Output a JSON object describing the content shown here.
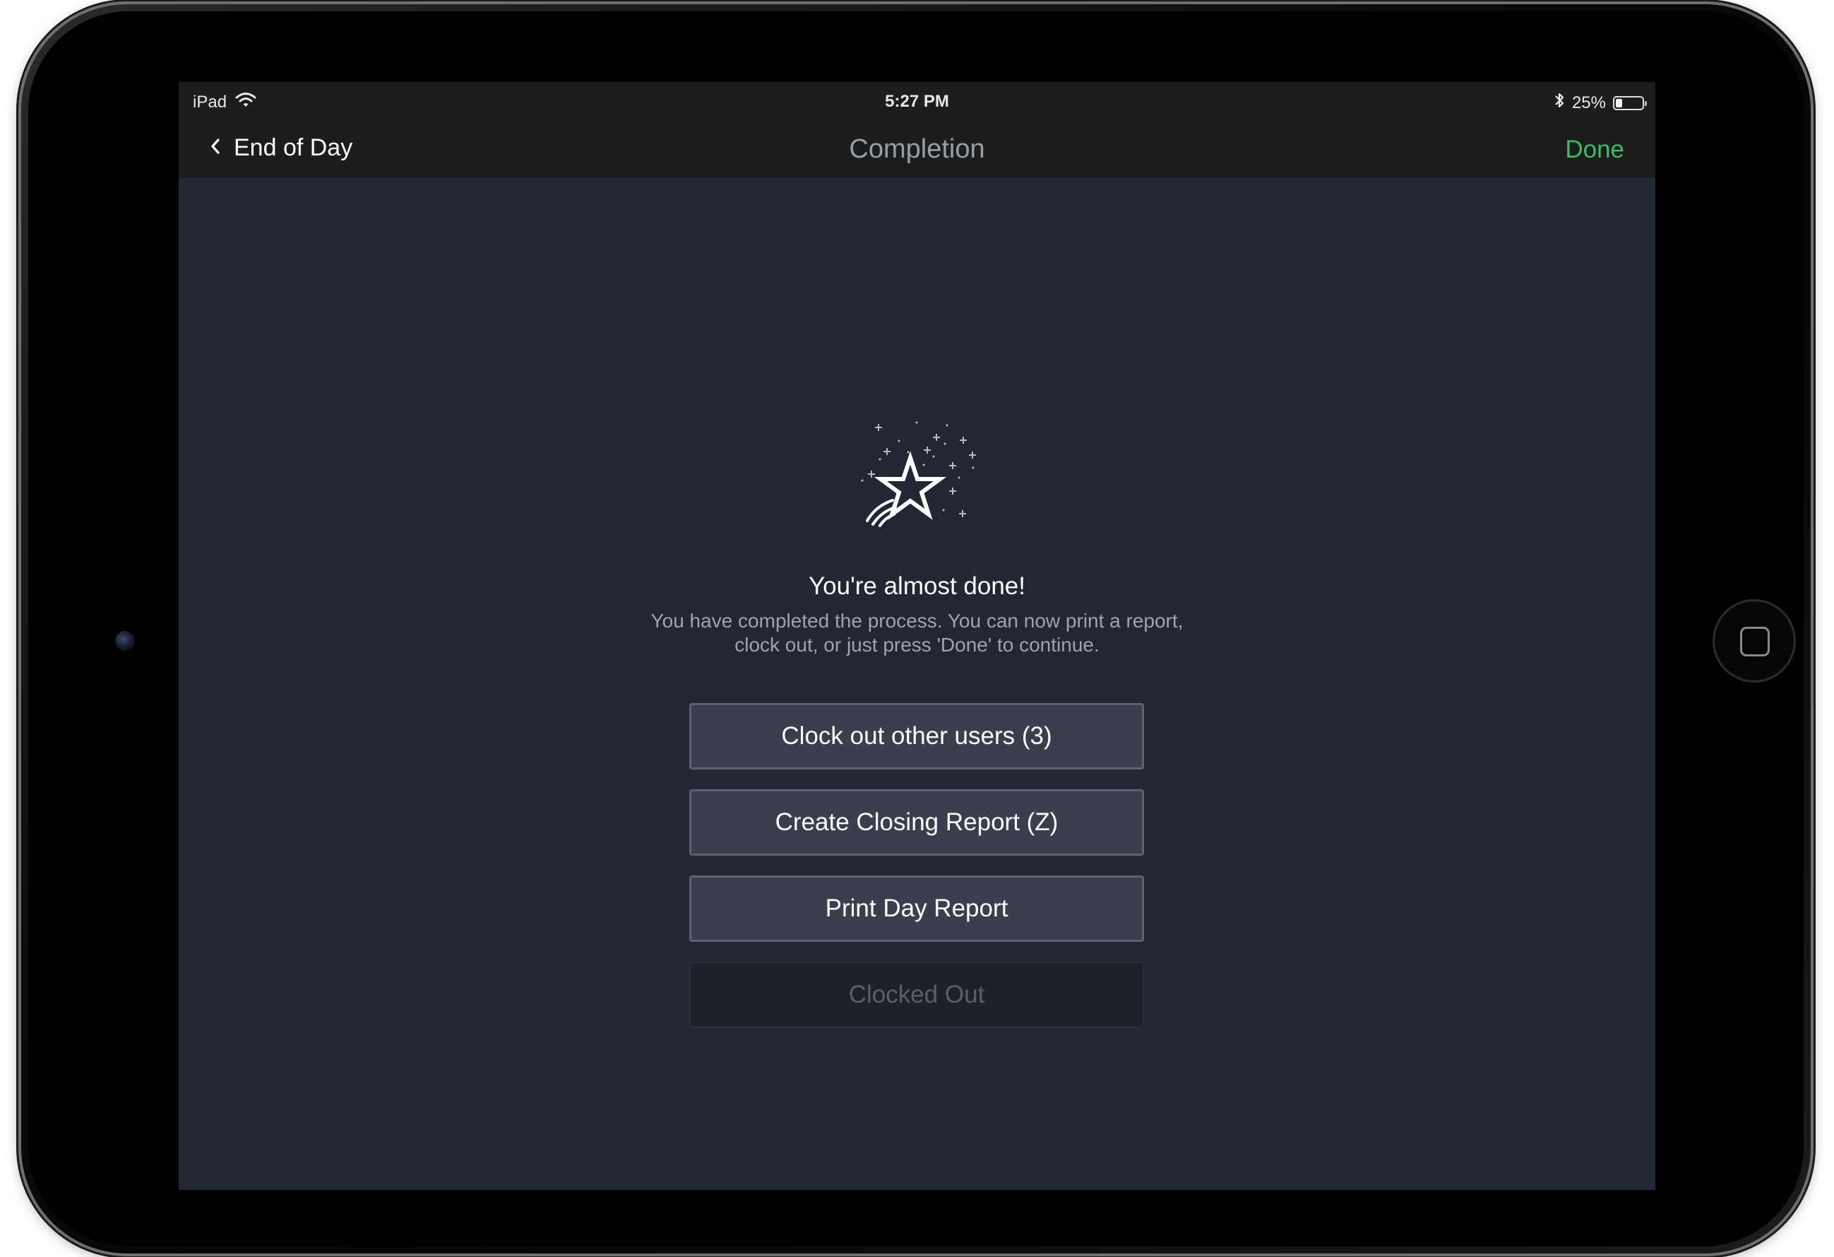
{
  "status_bar": {
    "device": "iPad",
    "time": "5:27 PM",
    "battery": "25%",
    "battery_level": 0.25
  },
  "nav": {
    "back_label": "End of Day",
    "title": "Completion",
    "done_label": "Done"
  },
  "main": {
    "headline": "You're almost done!",
    "message_line1": "You have completed the process. You can now print a report,",
    "message_line2": "clock out, or just press 'Done' to continue.",
    "buttons": [
      {
        "label": "Clock out other users (3)",
        "enabled": true
      },
      {
        "label": "Create Closing Report (Z)",
        "enabled": true
      },
      {
        "label": "Print Day Report",
        "enabled": true
      },
      {
        "label": "Clocked Out",
        "enabled": false
      }
    ]
  },
  "icons": {
    "wifi": "wifi-icon",
    "bluetooth": "bluetooth-icon",
    "battery": "battery-icon",
    "back": "chevron-left-icon",
    "hero": "shooting-star-icon",
    "home": "home-button"
  },
  "colors": {
    "background": "#232733",
    "bar": "#1c1d1f",
    "accent": "#3dbd5e",
    "button": "#3b3f4d"
  }
}
